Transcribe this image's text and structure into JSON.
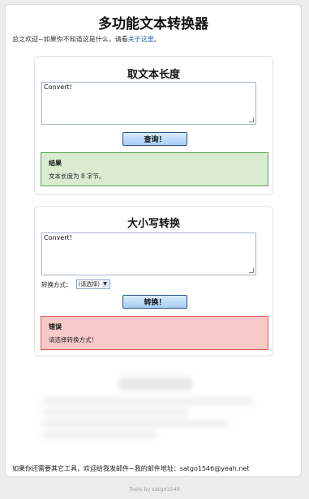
{
  "header": {
    "title": "多功能文本转换器"
  },
  "intro": {
    "text": "总之欢迎~如果你不知道这是什么，请看",
    "link": "关于这里",
    "suffix": "。"
  },
  "length_card": {
    "title": "取文本长度",
    "input_value": "Convert!",
    "button": "查询！",
    "result_title": "结果",
    "result_text": "文本长度为 8 字节。"
  },
  "case_card": {
    "title": "大小写转换",
    "input_value": "Convert!",
    "mode_label": "转换方式：",
    "mode_selected": "(请选择)",
    "button": "转换！",
    "error_title": "错误",
    "error_text": "请选择转换方式！"
  },
  "footer": {
    "text": "如果你还需要其它工具，欢迎给我发邮件~我的邮件地址：satgo1546@yeah.net",
    "credit": "Tools by satgo1546"
  }
}
